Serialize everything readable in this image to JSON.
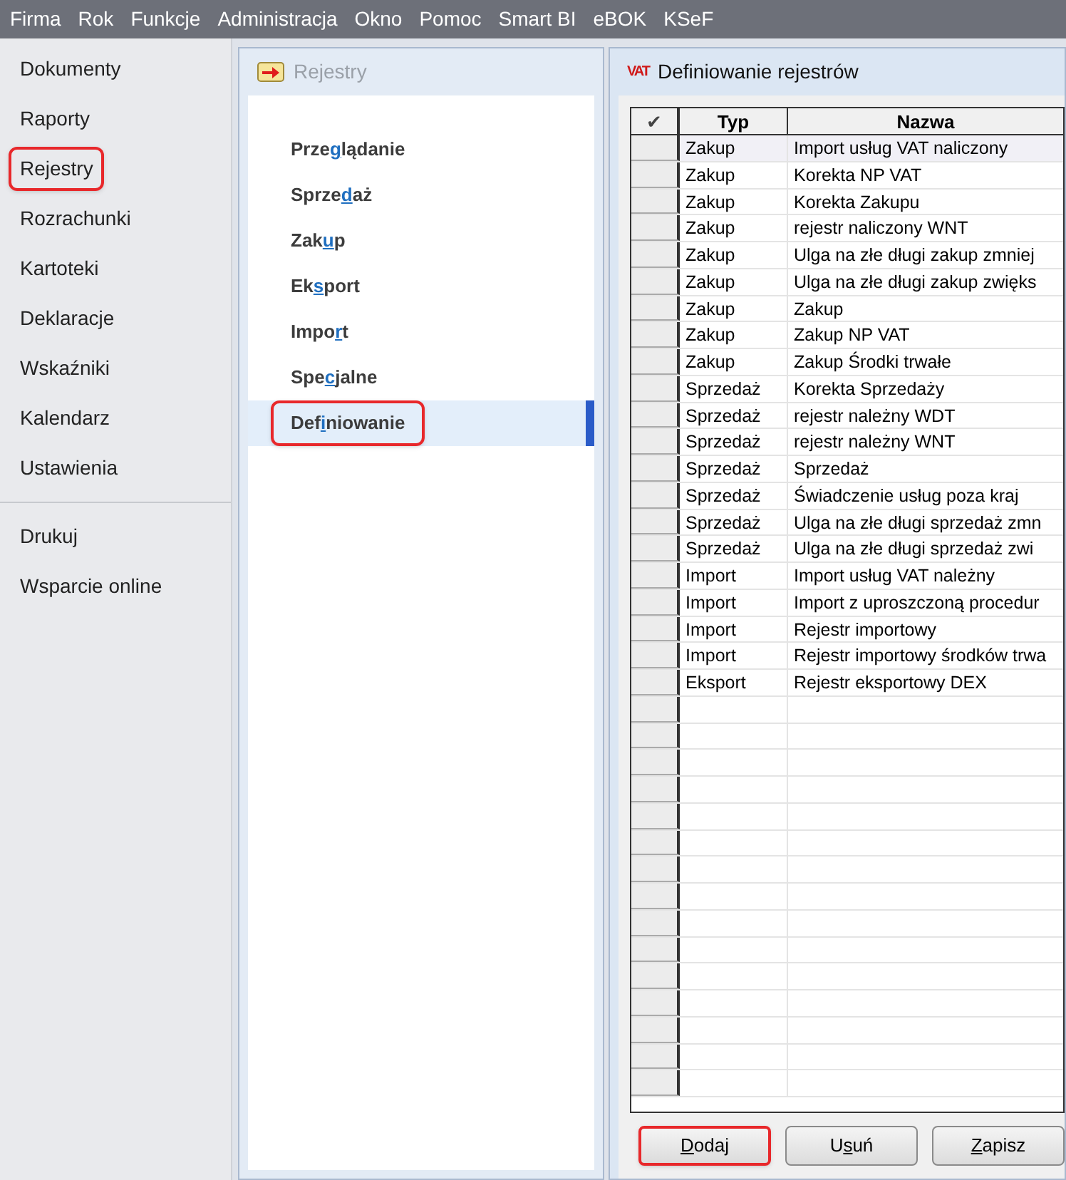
{
  "menu_bar": [
    "Firma",
    "Rok",
    "Funkcje",
    "Administracja",
    "Okno",
    "Pomoc",
    "Smart BI",
    "eBOK",
    "KSeF"
  ],
  "sidebar": {
    "items": [
      {
        "label": "Dokumenty",
        "highlighted": false
      },
      {
        "label": "Raporty",
        "highlighted": false
      },
      {
        "label": "Rejestry",
        "highlighted": true
      },
      {
        "label": "Rozrachunki",
        "highlighted": false
      },
      {
        "label": "Kartoteki",
        "highlighted": false
      },
      {
        "label": "Deklaracje",
        "highlighted": false
      },
      {
        "label": "Wskaźniki",
        "highlighted": false
      },
      {
        "label": "Kalendarz",
        "highlighted": false
      },
      {
        "label": "Ustawienia",
        "highlighted": false
      }
    ],
    "items_below_divider": [
      {
        "label": "Drukuj",
        "highlighted": false
      },
      {
        "label": "Wsparcie online",
        "highlighted": false
      }
    ]
  },
  "registers_panel": {
    "title": "Rejestry",
    "items": [
      {
        "pre": "Prze",
        "key": "g",
        "post": "lądanie",
        "selected": false,
        "highlighted": false
      },
      {
        "pre": "Sprze",
        "key": "d",
        "post": "aż",
        "selected": false,
        "highlighted": false
      },
      {
        "pre": "Zak",
        "key": "u",
        "post": "p",
        "selected": false,
        "highlighted": false
      },
      {
        "pre": "Ek",
        "key": "s",
        "post": "port",
        "selected": false,
        "highlighted": false
      },
      {
        "pre": "Impo",
        "key": "r",
        "post": "t",
        "selected": false,
        "highlighted": false
      },
      {
        "pre": "Spe",
        "key": "c",
        "post": "jalne",
        "selected": false,
        "highlighted": false
      },
      {
        "pre": "Def",
        "key": "i",
        "post": "niowanie",
        "selected": true,
        "highlighted": true
      }
    ]
  },
  "definitions_window": {
    "title": "Definiowanie rejestrów",
    "icon_text": "VAT",
    "table": {
      "columns": [
        "✔",
        "Typ",
        "Nazwa"
      ],
      "rows": [
        [
          "Zakup",
          "Import usług VAT naliczony"
        ],
        [
          "Zakup",
          "Korekta NP VAT"
        ],
        [
          "Zakup",
          "Korekta Zakupu"
        ],
        [
          "Zakup",
          "rejestr naliczony WNT"
        ],
        [
          "Zakup",
          "Ulga na złe długi zakup zmniej"
        ],
        [
          "Zakup",
          "Ulga na złe długi zakup zwięks"
        ],
        [
          "Zakup",
          "Zakup"
        ],
        [
          "Zakup",
          "Zakup NP VAT"
        ],
        [
          "Zakup",
          "Zakup Środki trwałe"
        ],
        [
          "Sprzedaż",
          "Korekta Sprzedaży"
        ],
        [
          "Sprzedaż",
          "rejestr należny WDT"
        ],
        [
          "Sprzedaż",
          "rejestr należny WNT"
        ],
        [
          "Sprzedaż",
          "Sprzedaż"
        ],
        [
          "Sprzedaż",
          "Świadczenie usług poza kraj"
        ],
        [
          "Sprzedaż",
          "Ulga na złe długi sprzedaż zmn"
        ],
        [
          "Sprzedaż",
          "Ulga na złe długi sprzedaż zwi"
        ],
        [
          "Import",
          "Import usług VAT należny"
        ],
        [
          "Import",
          "Import z uproszczoną procedur"
        ],
        [
          "Import",
          "Rejestr importowy"
        ],
        [
          "Import",
          "Rejestr importowy środków trwa"
        ],
        [
          "Eksport",
          "Rejestr eksportowy DEX"
        ]
      ]
    },
    "buttons": [
      {
        "key": "D",
        "post": "odaj",
        "highlighted": true
      },
      {
        "pre": "U",
        "key": "s",
        "post": "uń",
        "highlighted": false
      },
      {
        "key": "Z",
        "post": "apisz",
        "highlighted": false
      }
    ]
  }
}
